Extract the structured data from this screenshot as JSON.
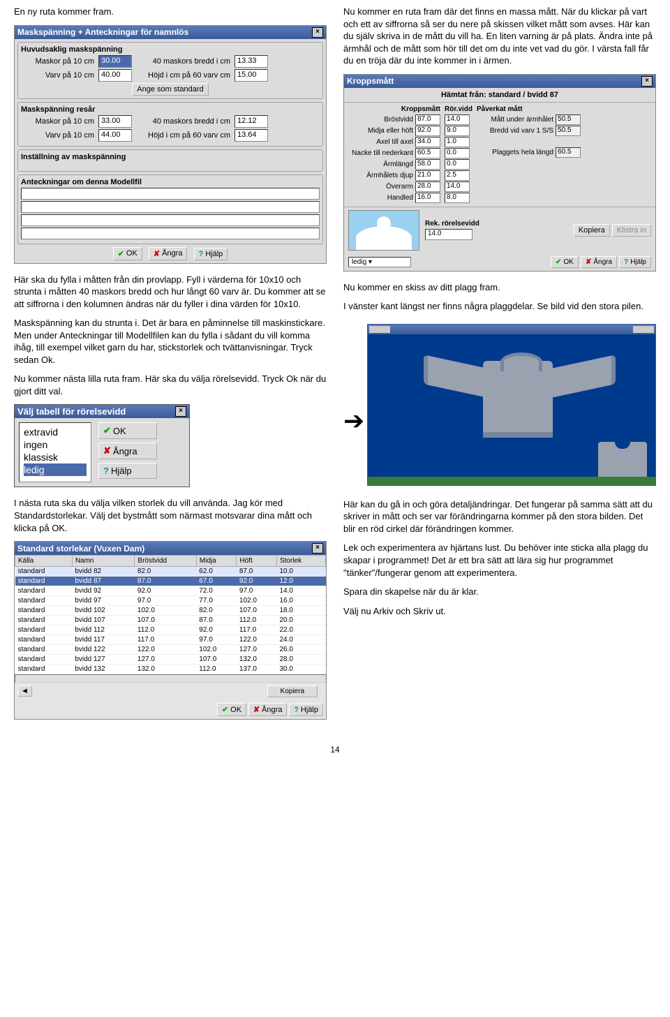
{
  "page_number": "14",
  "left": {
    "intro": "En ny ruta kommer fram.",
    "mask_dialog": {
      "title": "Maskspänning + Anteckningar för namnlös",
      "group1": "Huvudsaklig maskspänning",
      "g1": {
        "l1": "Maskor på 10 cm",
        "v1": "30.00",
        "l2": "40 maskors bredd i cm",
        "v2": "13.33",
        "l3": "Varv på 10 cm",
        "v3": "40.00",
        "l4": "Höjd i cm på 60 varv cm",
        "v4": "15.00",
        "btn": "Ange som standard"
      },
      "group2": "Maskspänning resår",
      "g2": {
        "l1": "Maskor på 10 cm",
        "v1": "33.00",
        "l2": "40 maskors bredd i cm",
        "v2": "12.12",
        "l3": "Varv på 10 cm",
        "v3": "44.00",
        "l4": "Höjd i cm på 60 varv cm",
        "v4": "13.64"
      },
      "group3": "Inställning av maskspänning",
      "group4": "Anteckningar om denna Modellfil",
      "ok": "OK",
      "cancel": "Ångra",
      "help": "Hjälp"
    },
    "p2": "Här ska du fylla i måtten från din provlapp. Fyll i värderna för 10x10 och strunta i måtten 40 maskors bredd och hur långt 60 varv är. Du kommer att se att siffrorna i den kolumnen ändras när du fyller i dina värden för 10x10.",
    "p3": "Maskspänning kan du strunta i. Det är bara en påminnelse till maskinstickare. Men under Anteckningar till Modellfilen kan du fylla i sådant du vill komma ihåg, till exempel vilket garn du har, stickstorlek och tvättanvisningar. Tryck sedan Ok.",
    "p4": "Nu kommer nästa lilla ruta fram. Här ska du välja rörelsevidd. Tryck Ok när du gjort ditt val.",
    "ror_dialog": {
      "title": "Välj tabell för rörelsevidd",
      "items": [
        "extravid",
        "ingen",
        "klassisk",
        "ledig"
      ],
      "selected": "ledig",
      "ok": "OK",
      "cancel": "Ångra",
      "help": "Hjälp"
    },
    "p5": "I nästa ruta ska du välja vilken storlek du vill använda. Jag kör med Standardstorlekar. Välj det bystmått som närmast motsvarar dina mått och klicka på OK.",
    "stor_dialog": {
      "title": "Standard storlekar  (Vuxen Dam)",
      "cols": [
        "Källa",
        "Namn",
        "Bröstvidd",
        "Midja",
        "Höft",
        "Storlek"
      ],
      "rows": [
        [
          "standard",
          "bvidd 82",
          "82.0",
          "62.0",
          "87.0",
          "10.0"
        ],
        [
          "standard",
          "bvidd 87",
          "87.0",
          "67.0",
          "92.0",
          "12.0"
        ],
        [
          "standard",
          "bvidd 92",
          "92.0",
          "72.0",
          "97.0",
          "14.0"
        ],
        [
          "standard",
          "bvidd 97",
          "97.0",
          "77.0",
          "102.0",
          "16.0"
        ],
        [
          "standard",
          "bvidd 102",
          "102.0",
          "82.0",
          "107.0",
          "18.0"
        ],
        [
          "standard",
          "bvidd 107",
          "107.0",
          "87.0",
          "112.0",
          "20.0"
        ],
        [
          "standard",
          "bvidd 112",
          "112.0",
          "92.0",
          "117.0",
          "22.0"
        ],
        [
          "standard",
          "bvidd 117",
          "117.0",
          "97.0",
          "122.0",
          "24.0"
        ],
        [
          "standard",
          "bvidd 122",
          "122.0",
          "102.0",
          "127.0",
          "26.0"
        ],
        [
          "standard",
          "bvidd 127",
          "127.0",
          "107.0",
          "132.0",
          "28.0"
        ],
        [
          "standard",
          "bvidd 132",
          "132.0",
          "112.0",
          "137.0",
          "30.0"
        ]
      ],
      "selected_index": 1,
      "kopiera": "Kopiera",
      "ok": "OK",
      "cancel": "Ångra",
      "help": "Hjälp"
    }
  },
  "right": {
    "p1": "Nu kommer en ruta fram där det finns en massa mått. När du klickar på vart och ett av siffrorna så ser du nere på skissen vilket mått som avses. Här kan du själv skriva in de mått du vill ha. En liten varning är på plats. Ändra inte på ärmhål och de mått som hör till det om du inte vet vad du gör. I värsta fall får du en tröja där du inte kommer in i ärmen.",
    "km_dialog": {
      "title": "Kroppsmått",
      "subtitle": "Hämtat från: standard / bvidd 87",
      "col1_hdr": "Kroppsmått",
      "col2_hdr": "Rör.vidd",
      "col3_hdr": "Påverkat mått",
      "rows": [
        {
          "l": "Bröstvidd",
          "v": "87.0",
          "r": "14.0"
        },
        {
          "l": "Midja eller höft",
          "v": "92.0",
          "r": "9.0"
        },
        {
          "l": "Axel till axel",
          "v": "34.0",
          "r": "1.0"
        },
        {
          "l": "Nacke till nederkant",
          "v": "60.5",
          "r": "0.0"
        },
        {
          "l": "Ärmlängd",
          "v": "58.0",
          "r": "0.0"
        },
        {
          "l": "Ärmhålets djup",
          "v": "21.0",
          "r": "2.5"
        },
        {
          "l": "Överarm",
          "v": "28.0",
          "r": "14.0"
        },
        {
          "l": "Handled",
          "v": "16.0",
          "r": "8.0"
        }
      ],
      "extra": [
        {
          "l": "Mått under ärmhålet",
          "v": "50.5"
        },
        {
          "l": "Bredd vid varv 1 S/S",
          "v": "50.5"
        },
        {
          "l": "Plaggets hela längd",
          "v": "60.5"
        }
      ],
      "rek_label": "Rek. rörelsevidd",
      "rek_value": "14.0",
      "kopiera": "Kopiera",
      "klistra": "Klistra in",
      "dropdown": "ledig",
      "ok": "OK",
      "cancel": "Ångra",
      "help": "Hjälp"
    },
    "p2": "Nu kommer en skiss av ditt plagg fram.",
    "p3": "I vänster kant längst ner finns några plaggdelar. Se bild vid den stora pilen.",
    "p4": "Här kan du gå in och göra detaljändringar. Det fungerar på samma sätt att du skriver in mått och ser var förändringarna kommer på den stora bilden. Det blir en röd cirkel där förändringen kommer.",
    "p5": "Lek och experimentera av hjärtans lust. Du behöver inte sticka alla plagg du skapar i programmet! Det är ett bra sätt att lära sig hur programmet \"tänker\"/fungerar genom att experimentera.",
    "p6": "Spara din skapelse när du är klar.",
    "p7": "Välj nu Arkiv och Skriv ut."
  }
}
